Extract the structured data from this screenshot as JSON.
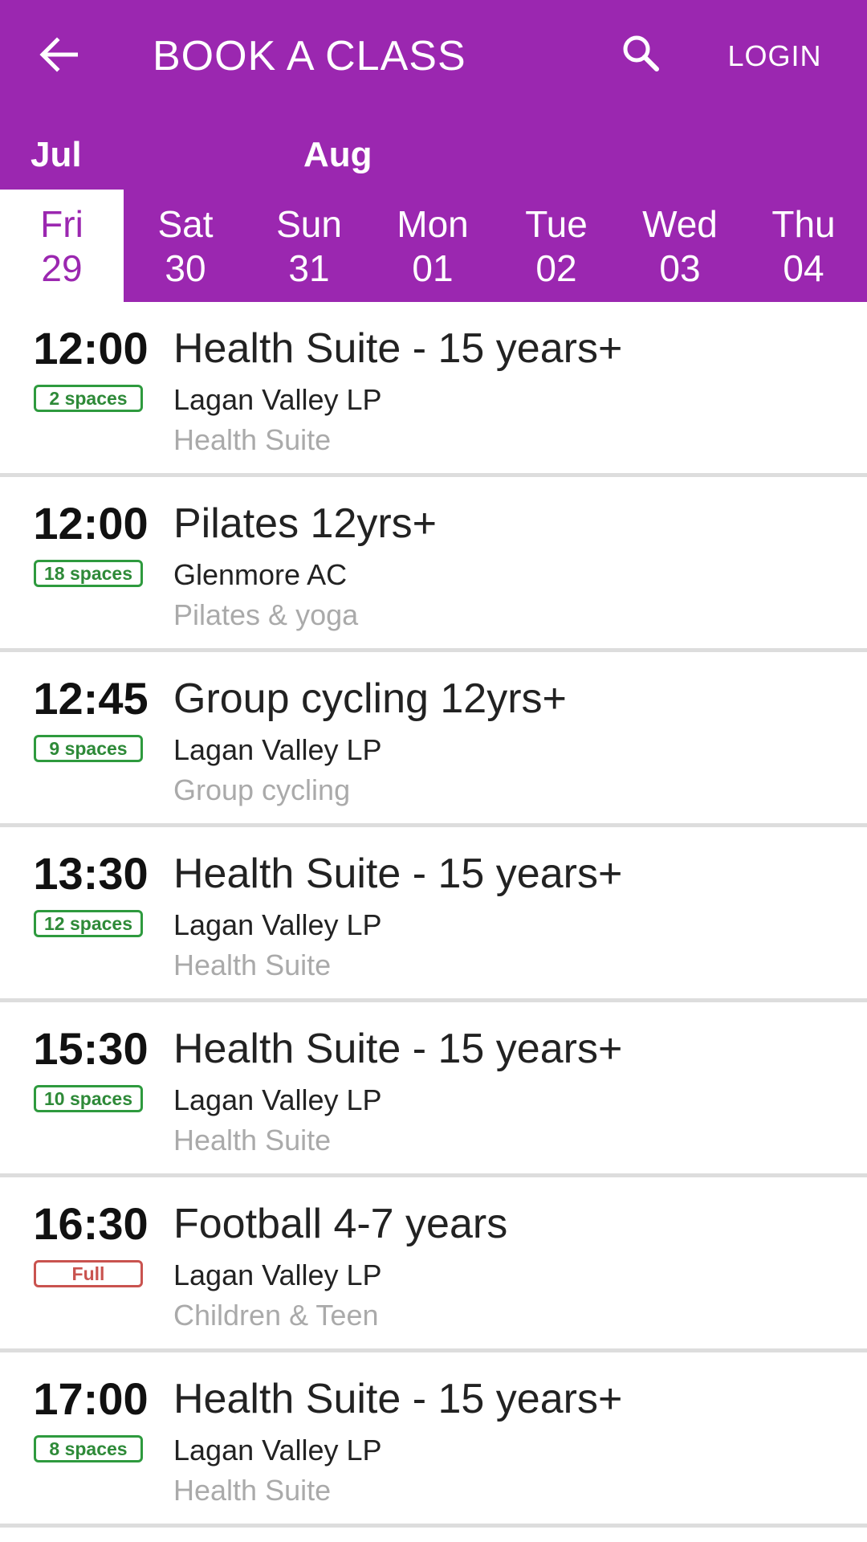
{
  "header": {
    "title": "BOOK A CLASS",
    "login_label": "LOGIN",
    "back_icon": "arrow-left-icon",
    "search_icon": "search-icon"
  },
  "months": [
    "Jul",
    "Aug"
  ],
  "days": [
    {
      "name": "Fri",
      "num": "29",
      "selected": true
    },
    {
      "name": "Sat",
      "num": "30"
    },
    {
      "name": "Sun",
      "num": "31"
    },
    {
      "name": "Mon",
      "num": "01"
    },
    {
      "name": "Tue",
      "num": "02"
    },
    {
      "name": "Wed",
      "num": "03"
    },
    {
      "name": "Thu",
      "num": "04"
    }
  ],
  "classes": [
    {
      "time": "12:00",
      "spaces": "2 spaces",
      "full": false,
      "name": "Health Suite - 15 years+",
      "venue": "Lagan Valley LP",
      "category": "Health Suite"
    },
    {
      "time": "12:00",
      "spaces": "18 spaces",
      "full": false,
      "name": "Pilates 12yrs+",
      "venue": "Glenmore AC",
      "category": "Pilates & yoga"
    },
    {
      "time": "12:45",
      "spaces": "9 spaces",
      "full": false,
      "name": "Group cycling 12yrs+",
      "venue": "Lagan Valley LP",
      "category": "Group cycling"
    },
    {
      "time": "13:30",
      "spaces": "12 spaces",
      "full": false,
      "name": "Health Suite - 15 years+",
      "venue": "Lagan Valley LP",
      "category": "Health Suite"
    },
    {
      "time": "15:30",
      "spaces": "10 spaces",
      "full": false,
      "name": "Health Suite - 15 years+",
      "venue": "Lagan Valley LP",
      "category": "Health Suite"
    },
    {
      "time": "16:30",
      "spaces": "Full",
      "full": true,
      "name": "Football 4-7 years",
      "venue": "Lagan Valley LP",
      "category": "Children & Teen"
    },
    {
      "time": "17:00",
      "spaces": "8 spaces",
      "full": false,
      "name": "Health Suite - 15 years+",
      "venue": "Lagan Valley LP",
      "category": "Health Suite"
    }
  ],
  "colors": {
    "primary": "#9b27b0",
    "available": "#2e9a3e",
    "full": "#c9534f",
    "muted_text": "#aaaaaa"
  }
}
